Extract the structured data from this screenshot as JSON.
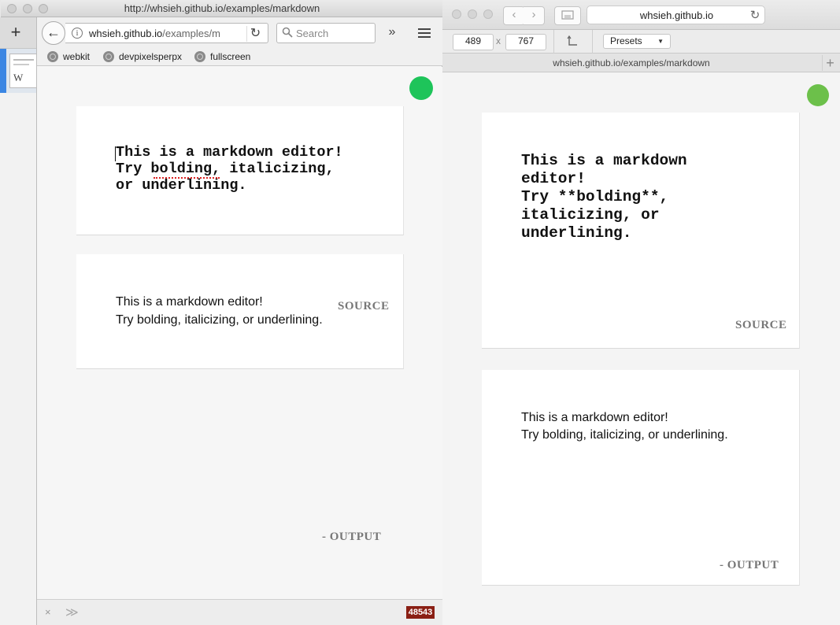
{
  "background_window": {
    "new_tab_label": "+",
    "thumbnail_glyph": "W"
  },
  "firefox": {
    "title": "http://whsieh.github.io/examples/markdown",
    "url_host": "whsieh.github.io",
    "url_path": "/examples/m",
    "info_glyph": "i",
    "search_placeholder": "Search",
    "bookmarks": [
      "webkit",
      "devpixelsperpx",
      "fullscreen"
    ],
    "editor_text": "This is a markdown editor!\nTry bolding, italicizing,\nor underlining.",
    "output_lines": [
      "This is a markdown editor!",
      "Try bolding, italicizing, or underlining."
    ],
    "source_label": "SOURCE",
    "output_label": "- OUTPUT",
    "close_glyph": "×",
    "devtools_glyph": "≫",
    "badge": "48543",
    "status_dot_color": "#1ec45a",
    "badge_color": "#8a1f14"
  },
  "safari": {
    "address": "whsieh.github.io",
    "width_value": "489",
    "height_value": "767",
    "times_glyph": "x",
    "presets_label": "Presets",
    "tab_title": "whsieh.github.io/examples/markdown",
    "new_tab_glyph": "+",
    "editor_text": "This is a markdown\neditor!\nTry **bolding**,\nitalicizing, or\nunderlining.",
    "output_lines": [
      "This is a markdown editor!",
      "Try bolding, italicizing, or underlining."
    ],
    "source_label": "SOURCE",
    "output_label": "- OUTPUT",
    "status_dot_color": "#6cc04a"
  },
  "icons": [
    "back-arrow-icon",
    "info-icon",
    "reload-icon",
    "search-icon",
    "overflow-chevron-icon",
    "hamburger-menu-icon",
    "globe-icon",
    "close-icon",
    "devtools-icon",
    "sidebar-icon",
    "rotate-icon",
    "dropdown-arrow-icon"
  ]
}
